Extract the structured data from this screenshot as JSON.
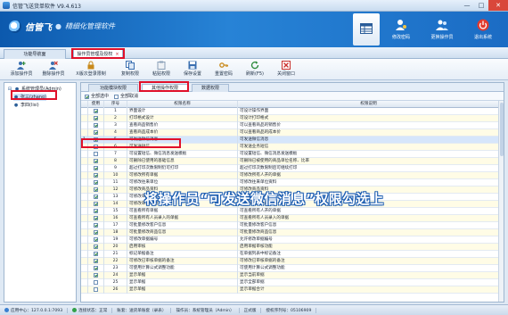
{
  "window": {
    "title": "信管飞送货单软件 V9.4.613",
    "controls": [
      "—",
      "□",
      "✕"
    ]
  },
  "banner": {
    "logo_text": "信管飞",
    "slogan": "精细化管理软件",
    "tools": [
      {
        "label": "",
        "icon": "table-icon"
      },
      {
        "label": "修改密码",
        "icon": "user-key-icon"
      },
      {
        "label": "更换操作员",
        "icon": "users-icon"
      },
      {
        "label": "退出系统",
        "icon": "power-icon"
      }
    ]
  },
  "nav_tabs": [
    {
      "label": "功能导航面"
    },
    {
      "label": "操作员管理及授权",
      "close": "×"
    }
  ],
  "toolbar": [
    {
      "label": "添加操作员",
      "icon": "add-user-icon",
      "color": "#2e8b3c"
    },
    {
      "label": "删除操作员",
      "icon": "delete-user-icon",
      "color": "#c9302c"
    },
    {
      "label": "X版次登录限制",
      "icon": "lock-icon",
      "color": "#c98a1c"
    },
    {
      "label": "复制权限",
      "icon": "copy-icon",
      "color": "#3a6fb0"
    },
    {
      "label": "粘贴权限",
      "icon": "paste-icon",
      "color": "#8aa0b8"
    },
    {
      "label": "保存设置",
      "icon": "save-icon",
      "color": "#3a6fb0"
    },
    {
      "label": "重置密码",
      "icon": "key-icon",
      "color": "#c98a1c"
    },
    {
      "label": "刷新(F5)",
      "icon": "refresh-icon",
      "color": "#2e8b3c"
    },
    {
      "label": "关闭窗口",
      "icon": "close-window-icon",
      "color": "#c9302c"
    }
  ],
  "tree": [
    {
      "label": "系统管理员(Admin)",
      "level": 0
    },
    {
      "label": "张三(zhang)",
      "level": 1,
      "selected": true
    },
    {
      "label": "李四(lisi)",
      "level": 1
    }
  ],
  "sub_tabs": [
    {
      "label": "功能模块权限"
    },
    {
      "label": "其他操作权限",
      "active": true
    },
    {
      "label": "数据权限"
    }
  ],
  "select_bar": {
    "select_all": "全部选中",
    "deselect_all": "全部取消"
  },
  "grid": {
    "columns": [
      "使用",
      "序号",
      "权限名称",
      "权限说明"
    ],
    "rows": [
      {
        "checked": true,
        "no": "1",
        "name": "界面设计",
        "desc": "可设计操作界面"
      },
      {
        "checked": true,
        "no": "2",
        "name": "打印格式设计",
        "desc": "可设计打印格式"
      },
      {
        "checked": true,
        "no": "3",
        "name": "查看商品销售价",
        "desc": "可以查看商品的销售价"
      },
      {
        "checked": true,
        "no": "4",
        "name": "查看商品成本价",
        "desc": "可以查看商品的成本价"
      },
      {
        "checked": true,
        "no": "5",
        "name": "可发送微信消息",
        "desc": "可发送微信消息",
        "current": true,
        "marker": "1"
      },
      {
        "checked": false,
        "no": "6",
        "name": "可发送短信",
        "desc": "可发送业务短信"
      },
      {
        "checked": false,
        "no": "7",
        "name": "可设置短信、微信消息发送模板",
        "desc": "可设置短信、微信消息发送模板"
      },
      {
        "checked": true,
        "no": "8",
        "name": "可删除已使用的基础信息",
        "desc": "可删除已被使用的商品单位名称、比率"
      },
      {
        "checked": true,
        "no": "9",
        "name": "超过打印次数限制仍可打印",
        "desc": "超过打印次数限制后可继续打印"
      },
      {
        "checked": true,
        "no": "10",
        "name": "可修改所有单据",
        "desc": "可修改所有人开的单据"
      },
      {
        "checked": true,
        "no": "11",
        "name": "可修改往来单位",
        "desc": "可修改往来单位资料"
      },
      {
        "checked": true,
        "no": "12",
        "name": "可修改商品资料",
        "desc": "可修改商品资料"
      },
      {
        "checked": true,
        "no": "13",
        "name": "可修改单据价格",
        "desc": "可修改单据中的价格"
      },
      {
        "checked": true,
        "no": "14",
        "name": "可修改单据日期",
        "desc": "可修改单据中的日期"
      },
      {
        "checked": true,
        "no": "15",
        "name": "可查看所有单据",
        "desc": "可查看所有人开的单据"
      },
      {
        "checked": true,
        "no": "16",
        "name": "可查看所有人员录入的单据",
        "desc": "可查看所有人员录入的单据"
      },
      {
        "checked": true,
        "no": "17",
        "name": "可批量修改客户信息",
        "desc": "可批量修改客户信息"
      },
      {
        "checked": true,
        "no": "18",
        "name": "可批量修改商品信息",
        "desc": "可批量修改商品信息"
      },
      {
        "checked": true,
        "no": "19",
        "name": "可修改单据编号",
        "desc": "允许修改单据编号"
      },
      {
        "checked": true,
        "no": "20",
        "name": "启用审核",
        "desc": "启用单据审核功能"
      },
      {
        "checked": true,
        "no": "21",
        "name": "标记单据备注",
        "desc": "在单据列表中标记备注"
      },
      {
        "checked": true,
        "no": "22",
        "name": "可修改已审核单据的备注",
        "desc": "可修改已审核单据的备注"
      },
      {
        "checked": true,
        "no": "23",
        "name": "可使用计算公式调整功能",
        "desc": "可使用计算公式调整功能"
      },
      {
        "checked": true,
        "no": "24",
        "name": "显示单据",
        "desc": "显示当前单据"
      },
      {
        "checked": false,
        "no": "25",
        "name": "显示单据",
        "desc": "显示全部单据"
      },
      {
        "checked": false,
        "no": "26",
        "name": "显示单据",
        "desc": "显示单据合计"
      }
    ]
  },
  "annotation": "将操作员“可发送微信消息”权限勾选上",
  "status_bar": {
    "center": "应用中心：127.0.0.1:7093",
    "conn": "连接状态：正常",
    "account": "账套：送货单账套（录表）",
    "operator": "操作员：系统管理员（Admin）",
    "version": "正式版",
    "license": "授权序列号：05106909"
  }
}
